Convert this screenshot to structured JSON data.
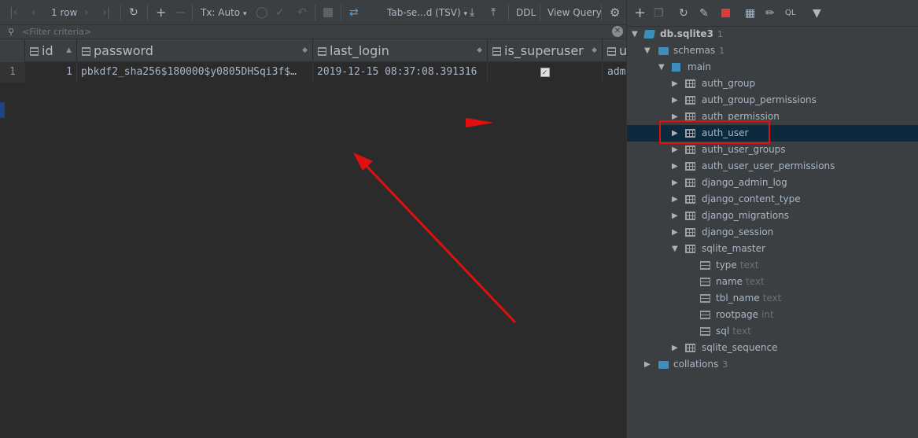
{
  "toolbar": {
    "row_count": "1 row",
    "tx_mode": "Tx: Auto",
    "export_format": "Tab-se...d (TSV)",
    "ddl_label": "DDL",
    "view_query_label": "View Query",
    "icons": [
      "first-page-icon",
      "prev-page-icon",
      "next-page-icon",
      "last-page-icon",
      "refresh-icon",
      "add-row-icon",
      "delete-row-icon",
      "submit-icon",
      "commit-icon",
      "rollback-icon",
      "stop-icon",
      "compare-icon",
      "download-icon",
      "upload-icon",
      "settings-icon"
    ]
  },
  "filter": {
    "placeholder": "<Filter criteria>"
  },
  "grid": {
    "columns": [
      {
        "name": "id"
      },
      {
        "name": "password"
      },
      {
        "name": "last_login"
      },
      {
        "name": "is_superuser"
      },
      {
        "name": "u"
      }
    ],
    "rows": [
      {
        "row_number": "1",
        "id": "1",
        "password": "pbkdf2_sha256$180000$y0805DHSqi3f$…",
        "last_login": "2019-12-15 08:37:08.391316",
        "is_superuser": true,
        "username": "adm"
      }
    ]
  },
  "db_tree": {
    "database": {
      "name": "db.sqlite3",
      "count": "1"
    },
    "schemas": {
      "label": "schemas",
      "count": "1"
    },
    "main": {
      "label": "main"
    },
    "tables": [
      {
        "name": "auth_group",
        "expanded": false
      },
      {
        "name": "auth_group_permissions",
        "expanded": false
      },
      {
        "name": "auth_permission",
        "expanded": false
      },
      {
        "name": "auth_user",
        "expanded": false,
        "selected": true
      },
      {
        "name": "auth_user_groups",
        "expanded": false
      },
      {
        "name": "auth_user_user_permissions",
        "expanded": false
      },
      {
        "name": "django_admin_log",
        "expanded": false
      },
      {
        "name": "django_content_type",
        "expanded": false
      },
      {
        "name": "django_migrations",
        "expanded": false
      },
      {
        "name": "django_session",
        "expanded": false
      },
      {
        "name": "sqlite_master",
        "expanded": true
      },
      {
        "name": "sqlite_sequence",
        "expanded": false
      }
    ],
    "sqlite_master_columns": [
      {
        "name": "type",
        "type": "text"
      },
      {
        "name": "name",
        "type": "text"
      },
      {
        "name": "tbl_name",
        "type": "text"
      },
      {
        "name": "rootpage",
        "type": "int"
      },
      {
        "name": "sql",
        "type": "text"
      }
    ],
    "collations": {
      "label": "collations",
      "count": "3"
    }
  },
  "colors": {
    "selection": "#0d293e",
    "annotation_red": "#e01010",
    "folder_blue": "#3d8dbd"
  }
}
